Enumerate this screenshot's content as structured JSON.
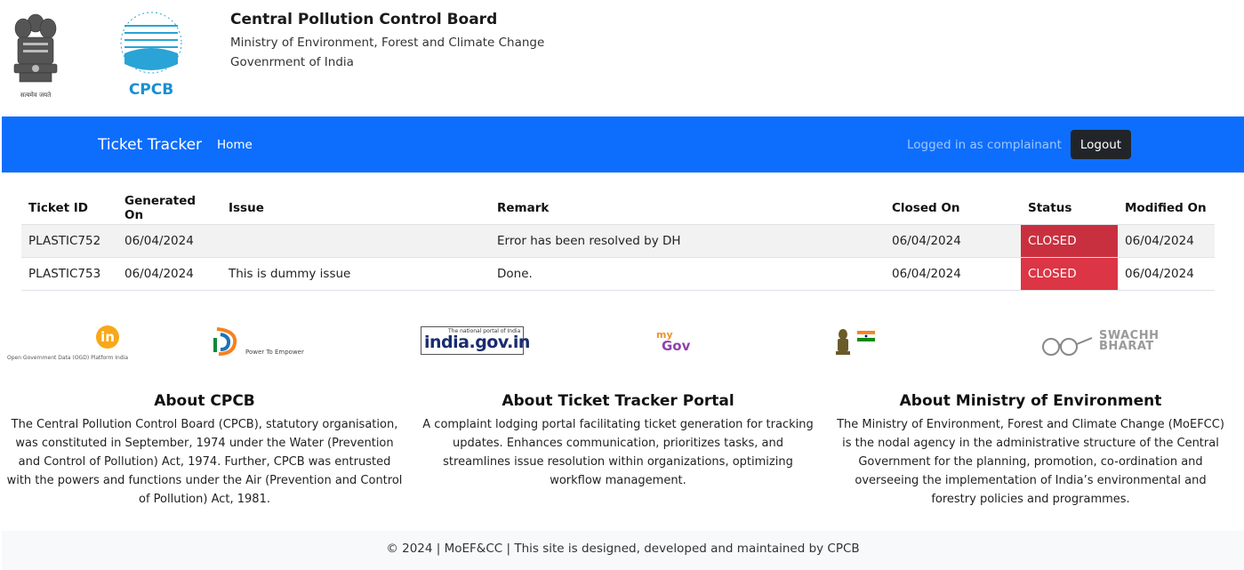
{
  "header": {
    "emblem_caption": "सत्यमेव जयते",
    "logo_text": "CPCB",
    "org_name": "Central Pollution Control Board",
    "ministry": "Ministry of Environment, Forest and Climate Change",
    "government": "Govenrment of India"
  },
  "navbar": {
    "brand": "Ticket Tracker",
    "home": "Home",
    "logged_in_text": "Logged in as complainant",
    "logout": "Logout",
    "color": "#0d6efd"
  },
  "table": {
    "columns": [
      "Ticket ID",
      "Generated On",
      "Issue",
      "Remark",
      "Closed On",
      "Status",
      "Modified On"
    ],
    "rows": [
      {
        "ticket_id": "PLASTIC752",
        "generated_on": "06/04/2024",
        "issue": "",
        "remark": "Error has been resolved by DH",
        "closed_on": "06/04/2024",
        "status": "CLOSED",
        "modified_on": "06/04/2024"
      },
      {
        "ticket_id": "PLASTIC753",
        "generated_on": "06/04/2024",
        "issue": "This is dummy issue",
        "remark": "Done.",
        "closed_on": "06/04/2024",
        "status": "CLOSED",
        "modified_on": "06/04/2024"
      }
    ],
    "status_color": "#dc3545"
  },
  "partners": {
    "ogd_label": "Open Government Data (OGD) Platform India",
    "ogd_icon": "in",
    "digital_india_label": "Power To Empower",
    "india_gov_top": "The national portal of India",
    "india_gov_main": "india.gov.in",
    "mygov_my": "my",
    "mygov_gov": "Gov",
    "swachh_line1": "SWACHH",
    "swachh_line2": "BHARAT"
  },
  "about": [
    {
      "title": "About CPCB",
      "text": "The Central Pollution Control Board (CPCB), statutory organisation, was constituted in September, 1974 under the Water (Prevention and Control of Pollution) Act, 1974. Further, CPCB was entrusted with the powers and functions under the Air (Prevention and Control of Pollution) Act, 1981."
    },
    {
      "title": "About Ticket Tracker Portal",
      "text": "A complaint lodging portal facilitating ticket generation for tracking updates. Enhances communication, prioritizes tasks, and streamlines issue resolution within organizations, optimizing workflow management."
    },
    {
      "title": "About Ministry of Environment",
      "text": "The Ministry of Environment, Forest and Climate Change (MoEFCC) is the nodal agency in the administrative structure of the Central Government for the planning, promotion, co-ordination and overseeing the implementation of India’s environmental and forestry policies and programmes."
    }
  ],
  "footer": {
    "text": "© 2024 | MoEF&CC | This site is designed, developed and maintained by CPCB"
  }
}
